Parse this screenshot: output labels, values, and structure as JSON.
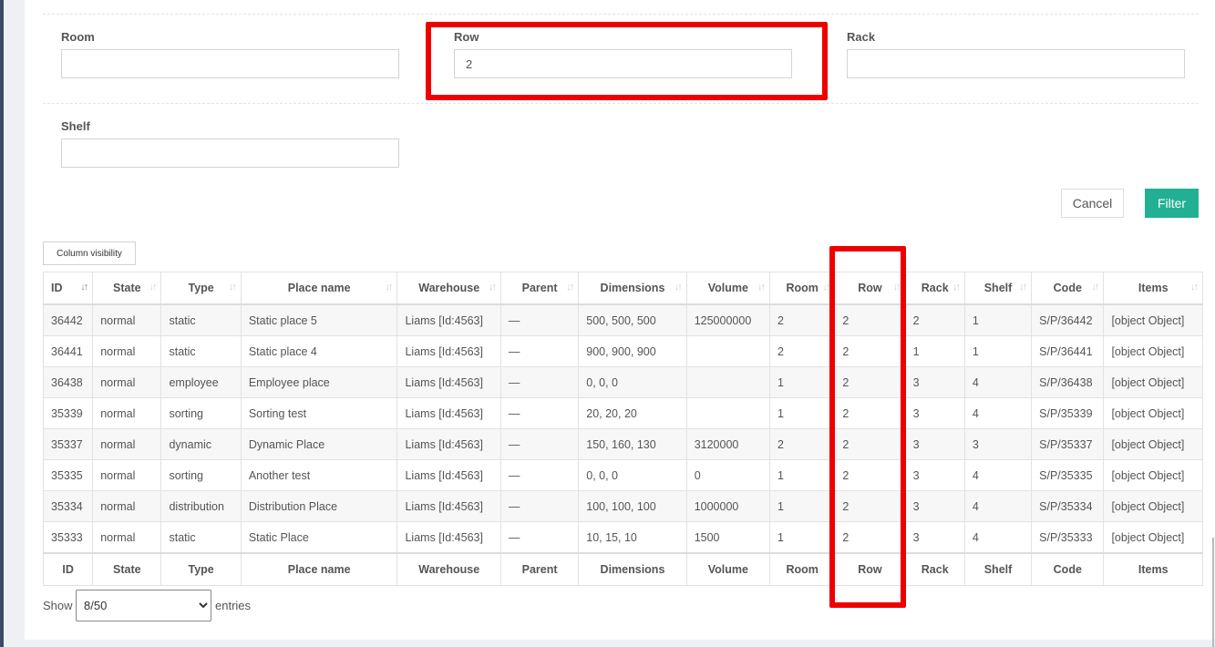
{
  "filters": {
    "room": {
      "label": "Room",
      "value": ""
    },
    "row": {
      "label": "Row",
      "value": "2"
    },
    "rack": {
      "label": "Rack",
      "value": ""
    },
    "shelf": {
      "label": "Shelf",
      "value": ""
    }
  },
  "buttons": {
    "cancel": "Cancel",
    "filter": "Filter",
    "column_visibility": "Column visibility"
  },
  "colors": {
    "accent": "#22b094",
    "highlight": "#ee0000"
  },
  "table": {
    "columns": [
      "ID",
      "State",
      "Type",
      "Place name",
      "Warehouse",
      "Parent",
      "Dimensions",
      "Volume",
      "Room",
      "Row",
      "Rack",
      "Shelf",
      "Code",
      "Items"
    ],
    "rows": [
      [
        "36442",
        "normal",
        "static",
        "Static place 5",
        "Liams [Id:4563]",
        "—",
        "500, 500, 500",
        "125000000",
        "2",
        "2",
        "2",
        "1",
        "S/P/36442",
        "[object Object]"
      ],
      [
        "36441",
        "normal",
        "static",
        "Static place 4",
        "Liams [Id:4563]",
        "—",
        "900, 900, 900",
        "",
        "2",
        "2",
        "1",
        "1",
        "S/P/36441",
        "[object Object]"
      ],
      [
        "36438",
        "normal",
        "employee",
        "Employee place",
        "Liams [Id:4563]",
        "—",
        "0, 0, 0",
        "",
        "1",
        "2",
        "3",
        "4",
        "S/P/36438",
        "[object Object]"
      ],
      [
        "35339",
        "normal",
        "sorting",
        "Sorting test",
        "Liams [Id:4563]",
        "—",
        "20, 20, 20",
        "",
        "1",
        "2",
        "3",
        "4",
        "S/P/35339",
        "[object Object]"
      ],
      [
        "35337",
        "normal",
        "dynamic",
        "Dynamic Place",
        "Liams [Id:4563]",
        "—",
        "150, 160, 130",
        "3120000",
        "2",
        "2",
        "3",
        "3",
        "S/P/35337",
        "[object Object]"
      ],
      [
        "35335",
        "normal",
        "sorting",
        "Another test",
        "Liams [Id:4563]",
        "—",
        "0, 0, 0",
        "0",
        "1",
        "2",
        "3",
        "4",
        "S/P/35335",
        "[object Object]"
      ],
      [
        "35334",
        "normal",
        "distribution",
        "Distribution Place",
        "Liams [Id:4563]",
        "—",
        "100, 100, 100",
        "1000000",
        "1",
        "2",
        "3",
        "4",
        "S/P/35334",
        "[object Object]"
      ],
      [
        "35333",
        "normal",
        "static",
        "Static Place",
        "Liams [Id:4563]",
        "—",
        "10, 15, 10",
        "1500",
        "1",
        "2",
        "3",
        "4",
        "S/P/35333",
        "[object Object]"
      ]
    ]
  },
  "pagination": {
    "show_label": "Show",
    "selected": "8/50",
    "options": [
      "8/50"
    ],
    "entries_label": "entries"
  }
}
